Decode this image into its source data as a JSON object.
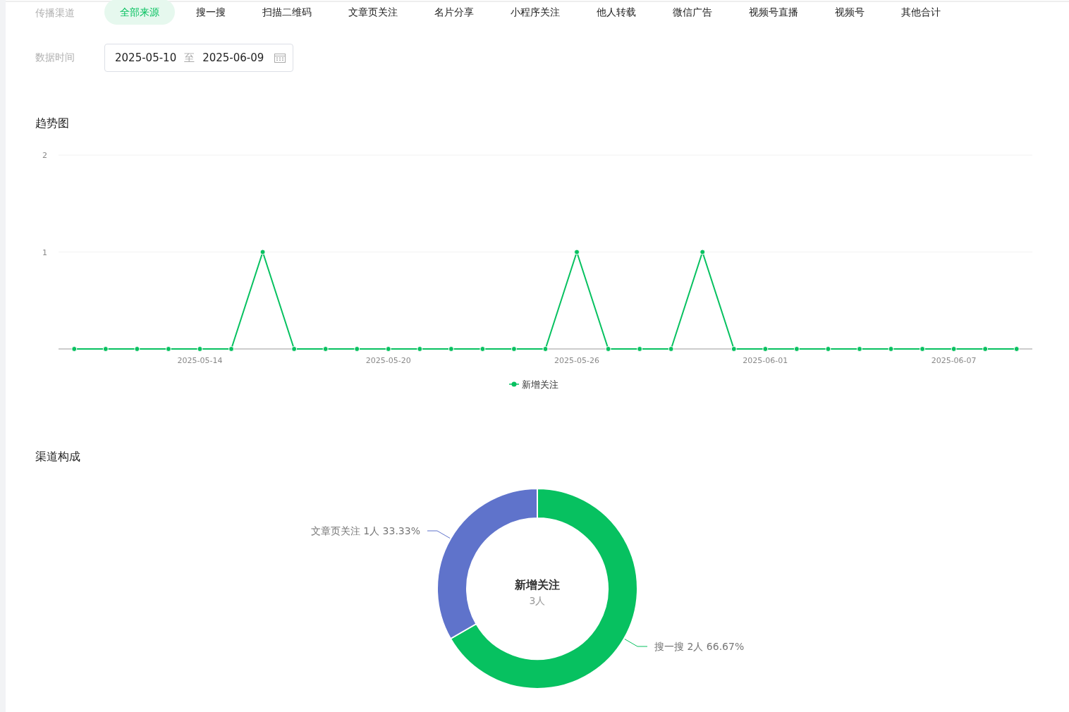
{
  "filters": {
    "channel_label": "传播渠道",
    "channels": [
      {
        "label": "全部来源",
        "selected": true
      },
      {
        "label": "搜一搜",
        "selected": false
      },
      {
        "label": "扫描二维码",
        "selected": false
      },
      {
        "label": "文章页关注",
        "selected": false
      },
      {
        "label": "名片分享",
        "selected": false
      },
      {
        "label": "小程序关注",
        "selected": false
      },
      {
        "label": "他人转载",
        "selected": false
      },
      {
        "label": "微信广告",
        "selected": false
      },
      {
        "label": "视频号直播",
        "selected": false
      },
      {
        "label": "视频号",
        "selected": false
      },
      {
        "label": "其他合计",
        "selected": false
      }
    ],
    "date_label": "数据时间",
    "date_range": {
      "start": "2025-05-10",
      "separator": "至",
      "end": "2025-06-09"
    }
  },
  "trend": {
    "title": "趋势图",
    "chart_data": {
      "type": "line",
      "categories": [
        null,
        null,
        null,
        null,
        "2025-05-14",
        null,
        null,
        null,
        null,
        null,
        "2025-05-20",
        null,
        null,
        null,
        null,
        null,
        "2025-05-26",
        null,
        null,
        null,
        null,
        null,
        "2025-06-01",
        null,
        null,
        null,
        null,
        null,
        "2025-06-07",
        null,
        null
      ],
      "series": [
        {
          "name": "新增关注",
          "color": "#07c160",
          "marker": "circle",
          "values": [
            0,
            0,
            0,
            0,
            0,
            0,
            1,
            0,
            0,
            0,
            0,
            0,
            0,
            0,
            0,
            0,
            1,
            0,
            0,
            0,
            1,
            0,
            0,
            0,
            0,
            0,
            0,
            0,
            0,
            0,
            0
          ]
        }
      ],
      "ylim": [
        0,
        2
      ],
      "yticks": [
        1,
        2
      ]
    }
  },
  "composition": {
    "title": "渠道构成",
    "chart_data": {
      "type": "donut",
      "title": "新增关注",
      "categories": [
        "搜一搜",
        "文章页关注"
      ],
      "values": [
        2,
        1
      ],
      "colors": [
        "#07c160",
        "#5f73cb"
      ],
      "value_labels": [
        "2人 66.67%",
        "1人 33.33%"
      ],
      "annotations": [
        "3人"
      ]
    }
  }
}
